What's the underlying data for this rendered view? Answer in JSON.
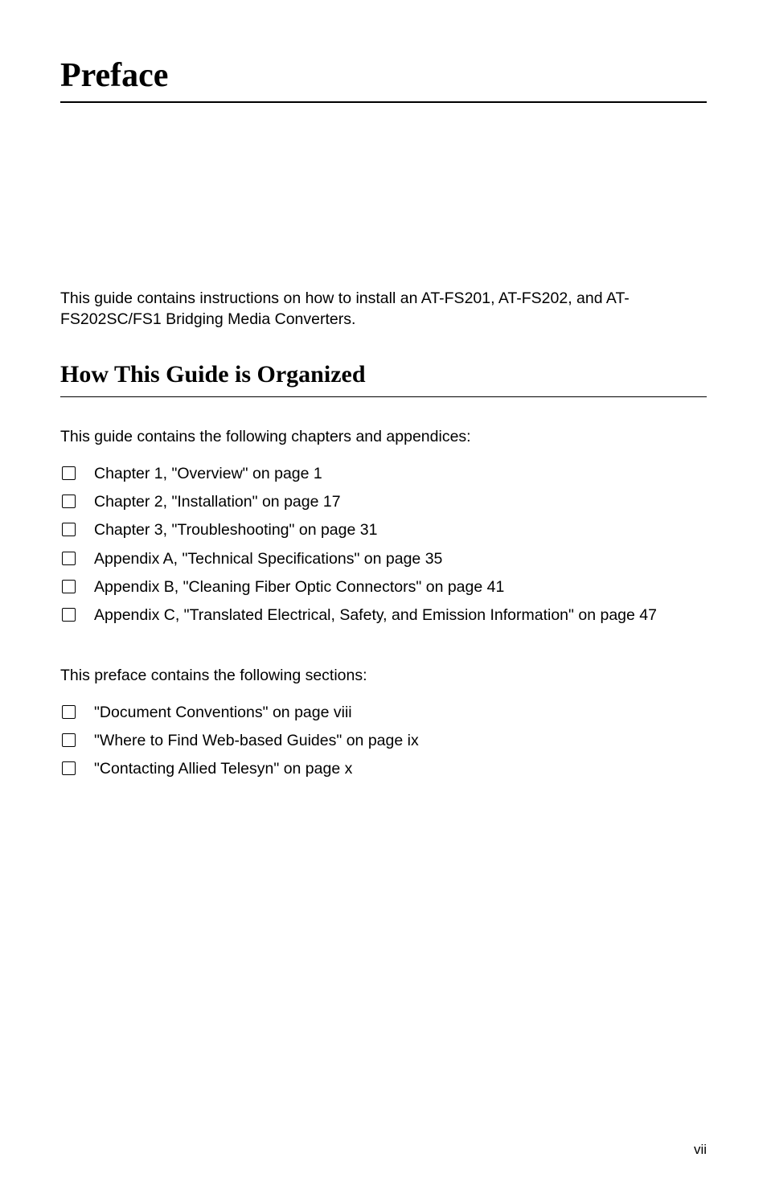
{
  "title": "Preface",
  "intro": "This guide contains instructions on how to install an AT-FS201, AT-FS202, and AT-FS202SC/FS1 Bridging Media Converters.",
  "heading": "How This Guide is Organized",
  "para1": "This guide contains the following chapters and appendices:",
  "list1": [
    "Chapter 1, \"Overview\" on page 1",
    "Chapter 2, \"Installation\" on page 17",
    "Chapter 3, \"Troubleshooting\" on page 31",
    "Appendix A, \"Technical Specifications\" on page 35",
    "Appendix B, \"Cleaning Fiber Optic Connectors\" on page 41",
    "Appendix C, \"Translated Electrical, Safety, and Emission Information\" on page 47"
  ],
  "para2": "This preface contains the following sections:",
  "list2": [
    "\"Document Conventions\" on page viii",
    "\"Where to Find Web-based Guides\" on page ix",
    "\"Contacting Allied Telesyn\" on page x"
  ],
  "pageNum": "vii"
}
